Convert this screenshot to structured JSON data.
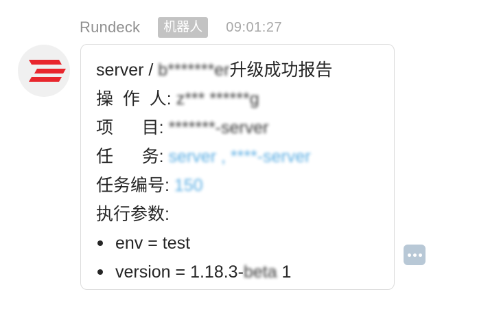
{
  "header": {
    "sender": "Rundeck",
    "badge": "机器人",
    "time": "09:01:27"
  },
  "message": {
    "title_prefix": "server / ",
    "title_blurred": "b*******er",
    "title_suffix": "升级成功报告",
    "fields": [
      {
        "label": "操  作  人: ",
        "value": "z*** ******g",
        "link": false
      },
      {
        "label": "项      目: ",
        "value": "*******-server",
        "link": false
      },
      {
        "label": "任      务: ",
        "value": "server , ****-server",
        "link": true
      },
      {
        "label": "任务编号: ",
        "value": "150",
        "link": true
      }
    ],
    "params_label": "执行参数:",
    "params": [
      {
        "text": "env = test",
        "blurred": ""
      },
      {
        "text": "version = 1.18.3-",
        "blurred": "beta",
        "suffix": " 1"
      }
    ]
  },
  "more_button": {
    "icon": "more-dots-icon"
  },
  "avatar": {
    "icon": "rundeck-logo-icon",
    "colors": {
      "bg": "#f0f0f0",
      "logo": "#e8262d"
    }
  }
}
